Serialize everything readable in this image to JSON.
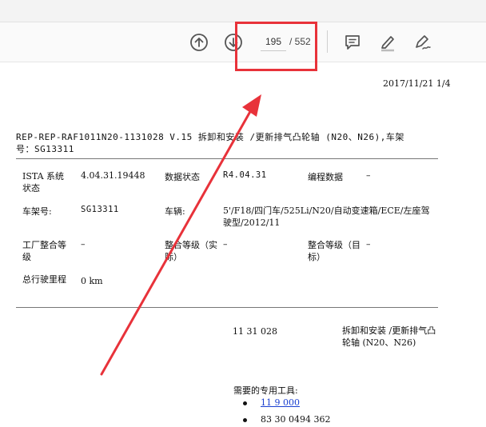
{
  "toolbar": {
    "current_page": "195",
    "total_pages": "/ 552",
    "icons": [
      "arrow-up-circle-icon",
      "arrow-down-circle-icon",
      "comment-icon",
      "highlighter-icon",
      "sign-pen-icon"
    ]
  },
  "annotation": {
    "color": "#e8323a"
  },
  "document": {
    "date_page": "2017/11/21 1/4",
    "title_line1": "REP-REP-RAF1011N20-1131028  V.15  拆卸和安装 /更新排气凸轮轴 (N20、N26),车架",
    "title_line2": "号：SG13311",
    "info": {
      "ista_label": "ISTA 系统状态",
      "ista_value": "4.04.31.19448",
      "data_status_label": "数据状态",
      "data_status_value": "R4.04.31",
      "prog_label": "编程数据",
      "prog_value": "–",
      "vin_label": "车架号:",
      "vin_value": "SG13311",
      "vehicle_label": "车辆:",
      "vehicle_value": "5'/F18/四门车/525Li/N20/自动变速箱/ECE/左座驾驶型/2012/11",
      "factory_label": "工厂整合等级",
      "factory_value": "–",
      "actual_label": "整合等级（实际）",
      "actual_value": "–",
      "target_label": "整合等级（目标）",
      "target_value": "–",
      "mileage_label": "总行驶里程",
      "mileage_value": "0 km"
    },
    "procedure_number": "11 31 028",
    "procedure_title": "拆卸和安装 /更新排气凸轮轴 (N20、N26)",
    "tools_heading": "需要的专用工具:",
    "tools": [
      {
        "text": "11 9 000",
        "is_link": true
      },
      {
        "text": "83 30 0494 362",
        "is_link": false
      }
    ]
  }
}
